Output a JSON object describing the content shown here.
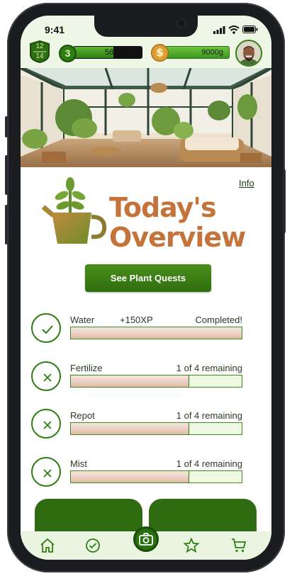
{
  "status_bar": {
    "time": "9:41"
  },
  "hud": {
    "level_current": "12",
    "level_max": "14",
    "xp_level": "3",
    "xp_percent_label": "58%",
    "xp_fraction": 0.58,
    "gold": "9000g",
    "coin_symbol": "$"
  },
  "header": {
    "info_link": "Info",
    "title_line1": "Today's",
    "title_line2": "Overview",
    "quests_button": "See Plant Quests"
  },
  "tasks": [
    {
      "name": "Water",
      "xp": "+150XP",
      "status": "Completed!",
      "progress": 1.0,
      "icon": "check-icon"
    },
    {
      "name": "Fertilize",
      "xp": "",
      "status": "1 of 4 remaining",
      "progress": 0.69,
      "icon": "x-icon"
    },
    {
      "name": "Repot",
      "xp": "",
      "status": "1 of 4 remaining",
      "progress": 0.69,
      "icon": "x-icon"
    },
    {
      "name": "Mist",
      "xp": "",
      "status": "1 of 4 remaining",
      "progress": 0.69,
      "icon": "x-icon"
    }
  ],
  "tabbar": {
    "items": [
      "home-icon",
      "check-circle-icon",
      "camera-icon",
      "star-icon",
      "cart-icon"
    ]
  },
  "colors": {
    "accent_green": "#2f6d0f",
    "title_orange": "#c4743b",
    "hud_bg": "#eef6e6"
  }
}
